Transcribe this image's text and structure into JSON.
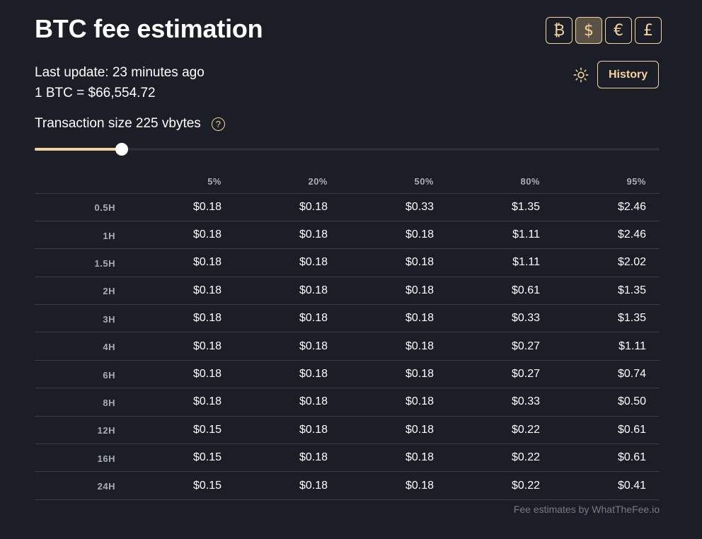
{
  "header": {
    "title": "BTC fee estimation",
    "currencies": [
      {
        "symbol": "₿",
        "active": false
      },
      {
        "symbol": "$",
        "active": true
      },
      {
        "symbol": "€",
        "active": false
      },
      {
        "symbol": "£",
        "active": false
      }
    ]
  },
  "info": {
    "last_update": "Last update: 23 minutes ago",
    "rate": "1 BTC = $66,554.72"
  },
  "controls": {
    "history_label": "History",
    "theme_icon": "sun-icon"
  },
  "transaction": {
    "size_label": "Transaction size 225 vbytes",
    "help_symbol": "?",
    "slider_fraction": 0.139
  },
  "table": {
    "columns": [
      "5%",
      "20%",
      "50%",
      "80%",
      "95%"
    ],
    "rows": [
      {
        "label": "0.5H",
        "values": [
          "$0.18",
          "$0.18",
          "$0.33",
          "$1.35",
          "$2.46"
        ]
      },
      {
        "label": "1H",
        "values": [
          "$0.18",
          "$0.18",
          "$0.18",
          "$1.11",
          "$2.46"
        ]
      },
      {
        "label": "1.5H",
        "values": [
          "$0.18",
          "$0.18",
          "$0.18",
          "$1.11",
          "$2.02"
        ]
      },
      {
        "label": "2H",
        "values": [
          "$0.18",
          "$0.18",
          "$0.18",
          "$0.61",
          "$1.35"
        ]
      },
      {
        "label": "3H",
        "values": [
          "$0.18",
          "$0.18",
          "$0.18",
          "$0.33",
          "$1.35"
        ]
      },
      {
        "label": "4H",
        "values": [
          "$0.18",
          "$0.18",
          "$0.18",
          "$0.27",
          "$1.11"
        ]
      },
      {
        "label": "6H",
        "values": [
          "$0.18",
          "$0.18",
          "$0.18",
          "$0.27",
          "$0.74"
        ]
      },
      {
        "label": "8H",
        "values": [
          "$0.18",
          "$0.18",
          "$0.18",
          "$0.33",
          "$0.50"
        ]
      },
      {
        "label": "12H",
        "values": [
          "$0.15",
          "$0.18",
          "$0.18",
          "$0.22",
          "$0.61"
        ]
      },
      {
        "label": "16H",
        "values": [
          "$0.15",
          "$0.18",
          "$0.18",
          "$0.22",
          "$0.61"
        ]
      },
      {
        "label": "24H",
        "values": [
          "$0.15",
          "$0.18",
          "$0.18",
          "$0.22",
          "$0.41"
        ]
      }
    ]
  },
  "footer": {
    "credit": "Fee estimates by WhatTheFee.io"
  }
}
